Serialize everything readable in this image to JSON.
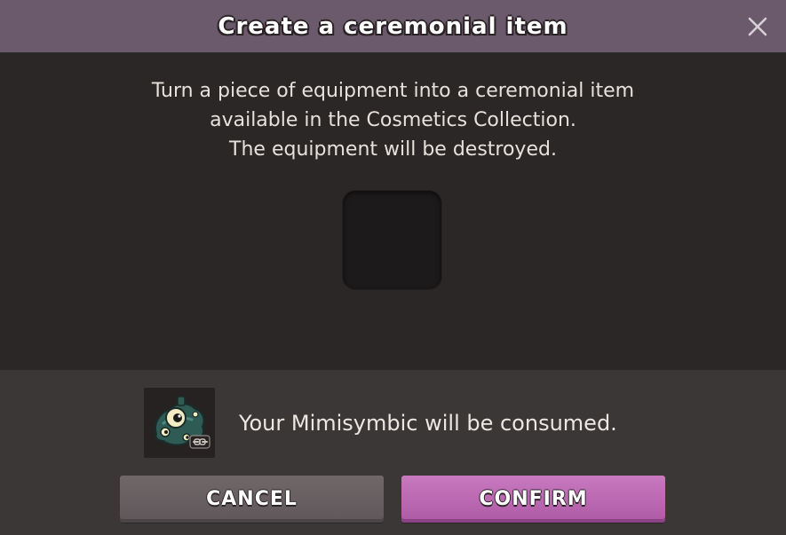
{
  "dialog": {
    "title": "Create a ceremonial item",
    "close_icon": "close-icon"
  },
  "description": {
    "line1": "Turn a piece of equipment into a ceremonial item",
    "line2": "available in the Cosmetics Collection.",
    "line3": "The equipment will be destroyed."
  },
  "slot": {
    "icon": "empty-equipment-slot"
  },
  "consumable": {
    "icon": "mimisymbic-icon",
    "text": "Your Mimisymbic will be consumed."
  },
  "buttons": {
    "cancel_label": "CANCEL",
    "confirm_label": "CONFIRM"
  },
  "colors": {
    "titlebar": "#6b5a6c",
    "body": "#2b2726",
    "footer": "#3b3737",
    "confirm": "#b862ae",
    "cancel": "#665e60"
  }
}
